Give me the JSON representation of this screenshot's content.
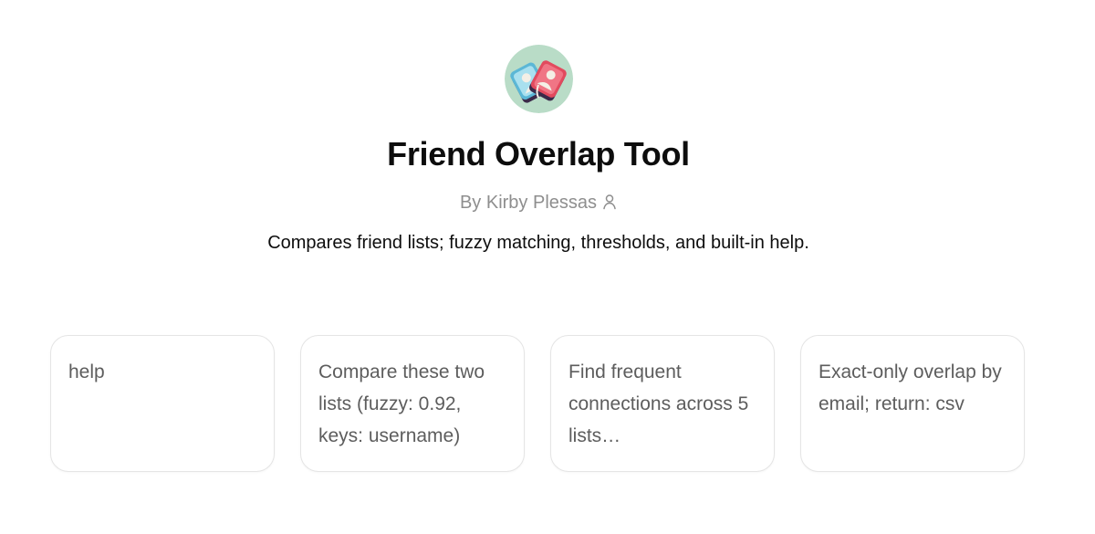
{
  "gpt": {
    "title": "Friend Overlap Tool",
    "author": "By Kirby Plessas",
    "description": "Compares friend lists; fuzzy matching, thresholds, and built-in help.",
    "logo_icon": "overlapping-cards-logo-icon",
    "author_icon": "person-icon"
  },
  "conversation_starters": [
    {
      "label": "help"
    },
    {
      "label": "Compare these two lists (fuzzy: 0.92, keys: username)"
    },
    {
      "label": "Find frequent connections across 5 lists…"
    },
    {
      "label": "Exact-only overlap by email; return: csv"
    }
  ],
  "colors": {
    "logo_background": "#b9dcc7",
    "card_blue": "#5bb7d6",
    "card_red": "#e24a5e",
    "card_dark": "#3b2a4a",
    "muted_text": "#8e8e8e",
    "starter_text": "#5d5d5d",
    "border": "#e5e5e5"
  }
}
